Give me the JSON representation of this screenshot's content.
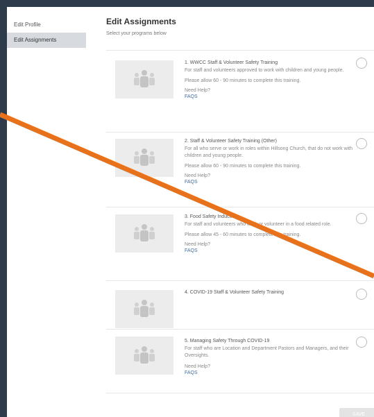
{
  "sidebar": {
    "items": [
      {
        "label": "Edit Profile"
      },
      {
        "label": "Edit Assignments"
      }
    ]
  },
  "header": {
    "title": "Edit Assignments",
    "subtitle": "Select your programs below"
  },
  "programs": [
    {
      "title": "1. WWCC Staff & Volunteer Safety Training",
      "description": "For staff and volunteers approved to work with children and young people.",
      "duration": "Please allow 60 - 90 minutes to complete this training.",
      "help": "Need Help?",
      "faq": "FAQS"
    },
    {
      "title": "2. Staff & Volunteer Safety Training (Other)",
      "description": "For all who serve or work in roles within Hillsong Church, that do not work with children and young people.",
      "duration": "Please allow 60 - 90 minutes to complete this training.",
      "help": "Need Help?",
      "faq": "FAQS"
    },
    {
      "title": "3. Food Safety Induction",
      "description": "For staff and volunteers who work or volunteer in a food related role.",
      "duration": "Please allow 45 - 60 minutes to complete this training.",
      "help": "Need Help?",
      "faq": "FAQS"
    },
    {
      "title": "4. COVID-19 Staff & Volunteer Safety Training"
    },
    {
      "title": "5. Managing Safety Through COVID-19",
      "description": "For staff who are Location and Department Pastors and Managers, and their Oversights.",
      "help": "Need Help?",
      "faq": "FAQS"
    }
  ],
  "footer": {
    "save_label": "SAVE"
  },
  "colors": {
    "frame_border": "#2d3b4a",
    "sidebar_active": "#d7dbe0",
    "link": "#3c6fa8",
    "annotation_line": "#e8721c"
  },
  "icons": {
    "thumbnail": "people-group-icon",
    "selector": "radio-circle-icon"
  }
}
